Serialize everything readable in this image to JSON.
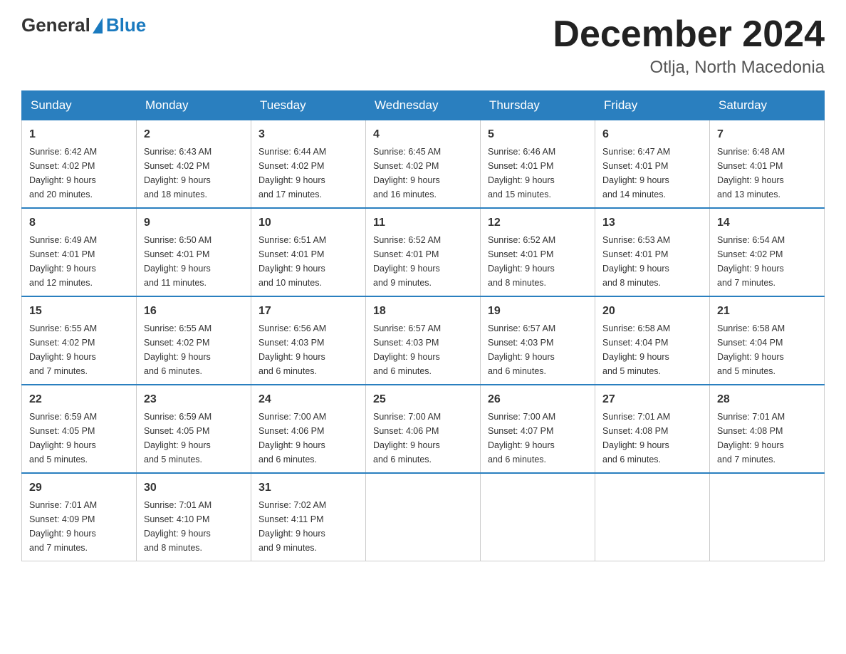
{
  "header": {
    "logo_general": "General",
    "logo_blue": "Blue",
    "month_title": "December 2024",
    "location": "Otlja, North Macedonia"
  },
  "days_of_week": [
    "Sunday",
    "Monday",
    "Tuesday",
    "Wednesday",
    "Thursday",
    "Friday",
    "Saturday"
  ],
  "weeks": [
    [
      {
        "day": "1",
        "sunrise": "6:42 AM",
        "sunset": "4:02 PM",
        "daylight": "9 hours and 20 minutes."
      },
      {
        "day": "2",
        "sunrise": "6:43 AM",
        "sunset": "4:02 PM",
        "daylight": "9 hours and 18 minutes."
      },
      {
        "day": "3",
        "sunrise": "6:44 AM",
        "sunset": "4:02 PM",
        "daylight": "9 hours and 17 minutes."
      },
      {
        "day": "4",
        "sunrise": "6:45 AM",
        "sunset": "4:02 PM",
        "daylight": "9 hours and 16 minutes."
      },
      {
        "day": "5",
        "sunrise": "6:46 AM",
        "sunset": "4:01 PM",
        "daylight": "9 hours and 15 minutes."
      },
      {
        "day": "6",
        "sunrise": "6:47 AM",
        "sunset": "4:01 PM",
        "daylight": "9 hours and 14 minutes."
      },
      {
        "day": "7",
        "sunrise": "6:48 AM",
        "sunset": "4:01 PM",
        "daylight": "9 hours and 13 minutes."
      }
    ],
    [
      {
        "day": "8",
        "sunrise": "6:49 AM",
        "sunset": "4:01 PM",
        "daylight": "9 hours and 12 minutes."
      },
      {
        "day": "9",
        "sunrise": "6:50 AM",
        "sunset": "4:01 PM",
        "daylight": "9 hours and 11 minutes."
      },
      {
        "day": "10",
        "sunrise": "6:51 AM",
        "sunset": "4:01 PM",
        "daylight": "9 hours and 10 minutes."
      },
      {
        "day": "11",
        "sunrise": "6:52 AM",
        "sunset": "4:01 PM",
        "daylight": "9 hours and 9 minutes."
      },
      {
        "day": "12",
        "sunrise": "6:52 AM",
        "sunset": "4:01 PM",
        "daylight": "9 hours and 8 minutes."
      },
      {
        "day": "13",
        "sunrise": "6:53 AM",
        "sunset": "4:01 PM",
        "daylight": "9 hours and 8 minutes."
      },
      {
        "day": "14",
        "sunrise": "6:54 AM",
        "sunset": "4:02 PM",
        "daylight": "9 hours and 7 minutes."
      }
    ],
    [
      {
        "day": "15",
        "sunrise": "6:55 AM",
        "sunset": "4:02 PM",
        "daylight": "9 hours and 7 minutes."
      },
      {
        "day": "16",
        "sunrise": "6:55 AM",
        "sunset": "4:02 PM",
        "daylight": "9 hours and 6 minutes."
      },
      {
        "day": "17",
        "sunrise": "6:56 AM",
        "sunset": "4:03 PM",
        "daylight": "9 hours and 6 minutes."
      },
      {
        "day": "18",
        "sunrise": "6:57 AM",
        "sunset": "4:03 PM",
        "daylight": "9 hours and 6 minutes."
      },
      {
        "day": "19",
        "sunrise": "6:57 AM",
        "sunset": "4:03 PM",
        "daylight": "9 hours and 6 minutes."
      },
      {
        "day": "20",
        "sunrise": "6:58 AM",
        "sunset": "4:04 PM",
        "daylight": "9 hours and 5 minutes."
      },
      {
        "day": "21",
        "sunrise": "6:58 AM",
        "sunset": "4:04 PM",
        "daylight": "9 hours and 5 minutes."
      }
    ],
    [
      {
        "day": "22",
        "sunrise": "6:59 AM",
        "sunset": "4:05 PM",
        "daylight": "9 hours and 5 minutes."
      },
      {
        "day": "23",
        "sunrise": "6:59 AM",
        "sunset": "4:05 PM",
        "daylight": "9 hours and 5 minutes."
      },
      {
        "day": "24",
        "sunrise": "7:00 AM",
        "sunset": "4:06 PM",
        "daylight": "9 hours and 6 minutes."
      },
      {
        "day": "25",
        "sunrise": "7:00 AM",
        "sunset": "4:06 PM",
        "daylight": "9 hours and 6 minutes."
      },
      {
        "day": "26",
        "sunrise": "7:00 AM",
        "sunset": "4:07 PM",
        "daylight": "9 hours and 6 minutes."
      },
      {
        "day": "27",
        "sunrise": "7:01 AM",
        "sunset": "4:08 PM",
        "daylight": "9 hours and 6 minutes."
      },
      {
        "day": "28",
        "sunrise": "7:01 AM",
        "sunset": "4:08 PM",
        "daylight": "9 hours and 7 minutes."
      }
    ],
    [
      {
        "day": "29",
        "sunrise": "7:01 AM",
        "sunset": "4:09 PM",
        "daylight": "9 hours and 7 minutes."
      },
      {
        "day": "30",
        "sunrise": "7:01 AM",
        "sunset": "4:10 PM",
        "daylight": "9 hours and 8 minutes."
      },
      {
        "day": "31",
        "sunrise": "7:02 AM",
        "sunset": "4:11 PM",
        "daylight": "9 hours and 9 minutes."
      },
      null,
      null,
      null,
      null
    ]
  ],
  "labels": {
    "sunrise": "Sunrise:",
    "sunset": "Sunset:",
    "daylight": "Daylight:"
  }
}
